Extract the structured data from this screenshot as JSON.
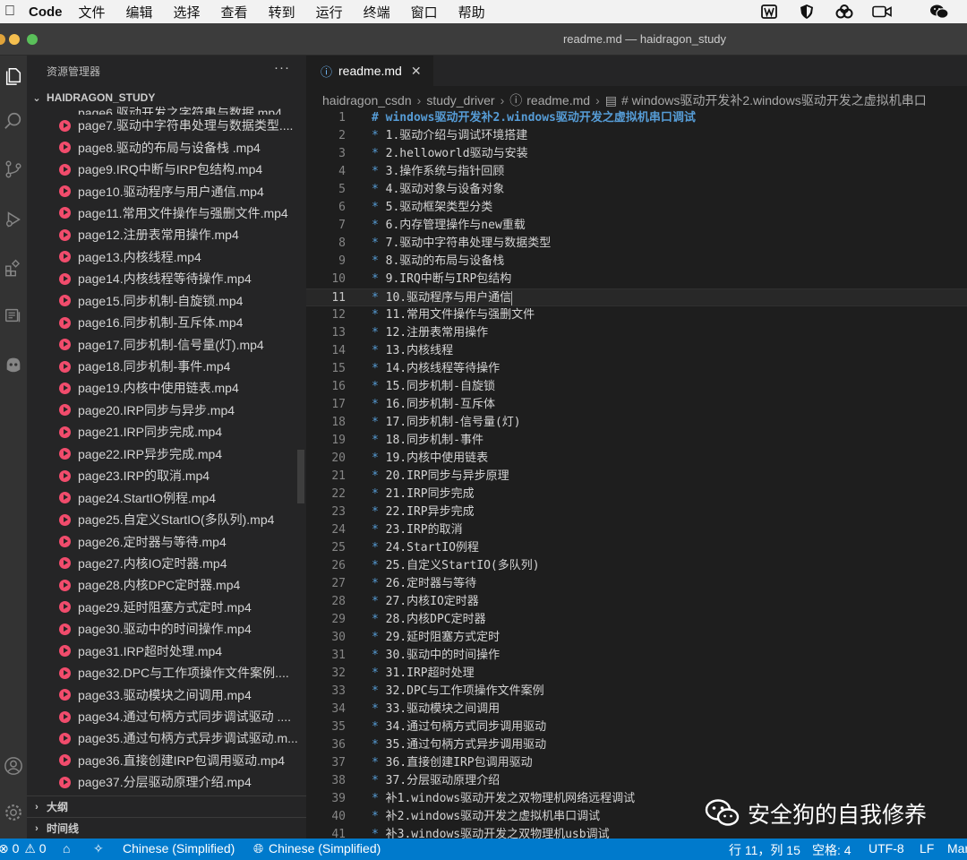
{
  "menubar": {
    "app_name": "Code",
    "items": [
      "文件",
      "编辑",
      "选择",
      "查看",
      "转到",
      "运行",
      "终端",
      "窗口",
      "帮助"
    ]
  },
  "titlebar": {
    "title": "readme.md — haidragon_study"
  },
  "sidebar": {
    "title": "资源管理器",
    "more": "···",
    "folder": "HAIDRAGON_STUDY",
    "partial_file": "page6.驱动开发之字符串与数据.mp4",
    "files": [
      "page7.驱动中字符串处理与数据类型....",
      "page8.驱动的布局与设备栈 .mp4",
      "page9.IRQ中断与IRP包结构.mp4",
      "page10.驱动程序与用户通信.mp4",
      "page11.常用文件操作与强删文件.mp4",
      "page12.注册表常用操作.mp4",
      "page13.内核线程.mp4",
      "page14.内核线程等待操作.mp4",
      "page15.同步机制-自旋锁.mp4",
      "page16.同步机制-互斥体.mp4",
      "page17.同步机制-信号量(灯).mp4",
      "page18.同步机制-事件.mp4",
      "page19.内核中使用链表.mp4",
      "page20.IRP同步与异步.mp4",
      "page21.IRP同步完成.mp4",
      "page22.IRP异步完成.mp4",
      "page23.IRP的取消.mp4",
      "page24.StartIO例程.mp4",
      "page25.自定义StartIO(多队列).mp4",
      "page26.定时器与等待.mp4",
      "page27.内核IO定时器.mp4",
      "page28.内核DPC定时器.mp4",
      "page29.延时阻塞方式定时.mp4",
      "page30.驱动中的时间操作.mp4",
      "page31.IRP超时处理.mp4",
      "page32.DPC与工作项操作文件案例....",
      "page33.驱动模块之间调用.mp4",
      "page34.通过句柄方式同步调试驱动 ....",
      "page35.通过句柄方式异步调试驱动.m...",
      "page36.直接创建IRP包调用驱动.mp4",
      "page37.分层驱动原理介绍.mp4"
    ],
    "sections": [
      "大纲",
      "时间线"
    ]
  },
  "editor": {
    "tab_label": "readme.md",
    "breadcrumbs": [
      "haidragon_csdn",
      "study_driver",
      "readme.md",
      "# windows驱动开发补2.windows驱动开发之虚拟机串口"
    ],
    "current_line": 11,
    "lines": [
      "# windows驱动开发补2.windows驱动开发之虚拟机串口调试",
      "* 1.驱动介绍与调试环境搭建",
      "* 2.helloworld驱动与安装",
      "* 3.操作系统与指针回顾",
      "* 4.驱动对象与设备对象",
      "* 5.驱动框架类型分类",
      "* 6.内存管理操作与new重载",
      "* 7.驱动中字符串处理与数据类型",
      "* 8.驱动的布局与设备栈",
      "* 9.IRQ中断与IRP包结构",
      "* 10.驱动程序与用户通信",
      "* 11.常用文件操作与强删文件",
      "* 12.注册表常用操作",
      "* 13.内核线程",
      "* 14.内核线程等待操作",
      "* 15.同步机制-自旋锁",
      "* 16.同步机制-互斥体",
      "* 17.同步机制-信号量(灯)",
      "* 18.同步机制-事件",
      "* 19.内核中使用链表",
      "* 20.IRP同步与异步原理",
      "* 21.IRP同步完成",
      "* 22.IRP异步完成",
      "* 23.IRP的取消",
      "* 24.StartIO例程",
      "* 25.自定义StartIO(多队列)",
      "* 26.定时器与等待",
      "* 27.内核IO定时器",
      "* 28.内核DPC定时器",
      "* 29.延时阻塞方式定时",
      "* 30.驱动中的时间操作",
      "* 31.IRP超时处理",
      "* 32.DPC与工作项操作文件案例",
      "* 33.驱动模块之间调用",
      "* 34.通过句柄方式同步调用驱动",
      "* 35.通过句柄方式异步调用驱动",
      "* 36.直接创建IRP包调用驱动",
      "* 37.分层驱动原理介绍",
      "* 补1.windows驱动开发之双物理机网络远程调试",
      "* 补2.windows驱动开发之虚拟机串口调试",
      "* 补3.windows驱动开发之双物理机usb调试"
    ]
  },
  "watermark": {
    "text": "安全狗的自我修养"
  },
  "statusbar": {
    "problems": "0",
    "warnings": "0",
    "lang1": "Chinese (Simplified)",
    "lang2": "Chinese (Simplified)",
    "position": "行 11，列 15",
    "spaces": "空格: 4",
    "encoding": "UTF-8",
    "eol": "LF",
    "mode": "Markdown"
  }
}
